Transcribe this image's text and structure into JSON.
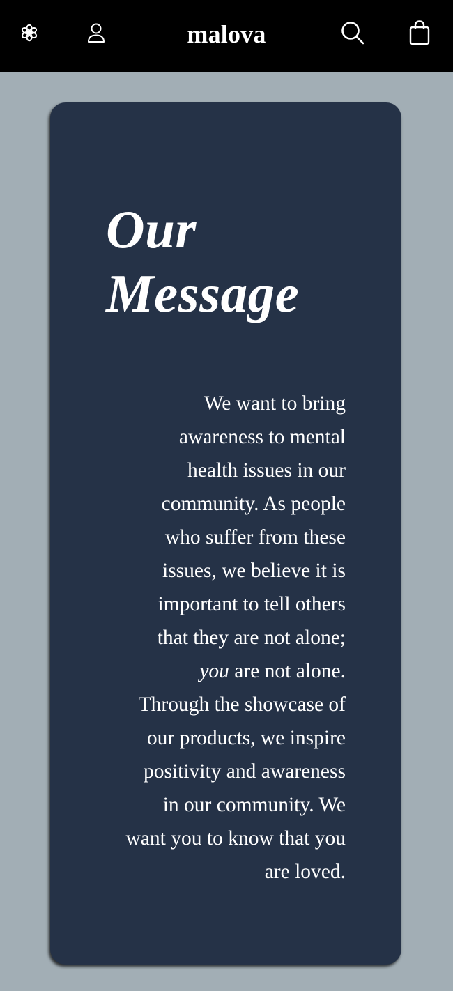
{
  "header": {
    "brand": "malova",
    "icons": {
      "menu": "flower-menu-icon",
      "account": "user-icon",
      "search": "search-icon",
      "cart": "shopping-bag-icon"
    },
    "colors": {
      "background": "#000000",
      "foreground": "#ffffff"
    }
  },
  "message": {
    "title_line1": "Our",
    "title_line2": "Message",
    "body": {
      "line1": "We want to bring",
      "line2": "awareness to mental",
      "line3": "health issues in our",
      "line4": "community. As people",
      "line5": "who suffer from these",
      "line6": "issues, we believe it is",
      "line7": "important to tell others",
      "line8": "that they are not alone;",
      "line9_em": "you",
      "line9_rest": " are not alone.",
      "line10": "Through the showcase of",
      "line11": "our products, we inspire",
      "line12": "positivity and awareness",
      "line13": "in our community. We",
      "line14": "want you to know that you",
      "line15": "are loved."
    },
    "colors": {
      "card": "#253247",
      "text": "#ffffff"
    }
  },
  "page": {
    "background": "#a2aeb5"
  }
}
